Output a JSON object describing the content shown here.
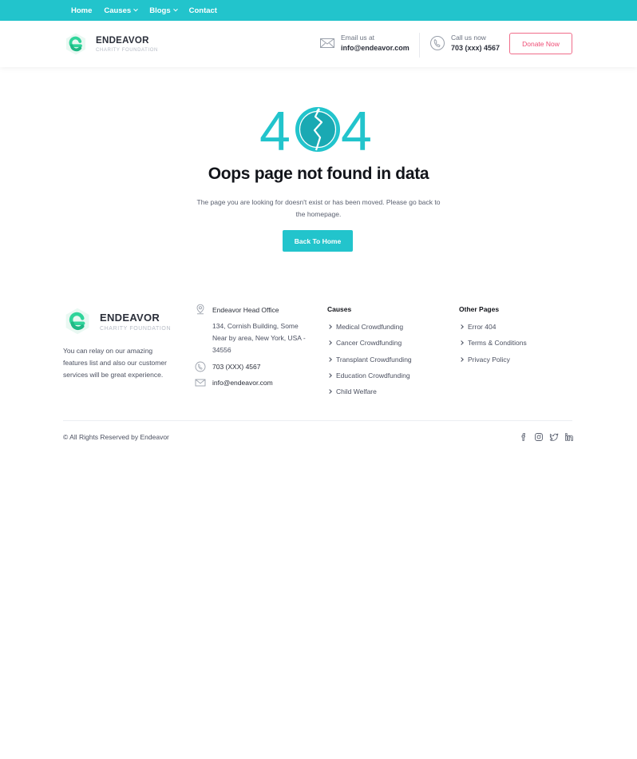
{
  "nav": {
    "items": [
      {
        "label": "Home",
        "has_dropdown": false
      },
      {
        "label": "Causes",
        "has_dropdown": true
      },
      {
        "label": "Blogs",
        "has_dropdown": true
      },
      {
        "label": "Contact",
        "has_dropdown": false
      }
    ]
  },
  "brand": {
    "name": "ENDEAVOR",
    "tagline": "CHARITY FOUNDATION",
    "colors": {
      "primary": "#22c4cc",
      "logo": "#2fd49a",
      "accent": "#ee4d75"
    }
  },
  "header": {
    "email_label": "Email us at",
    "email_value": "info@endeavor.com",
    "phone_label": "Call us now",
    "phone_value": "703 (xxx) 4567",
    "donate_label": "Donate Now"
  },
  "error": {
    "code_left": "4",
    "code_right": "4",
    "headline": "Oops page not found in data",
    "message": "The page you are looking for doesn't exist or has been moved. Please go back to the homepage.",
    "button_label": "Back To Home"
  },
  "footer": {
    "about": "You can relay on our amazing features list and also our customer services will be great experience.",
    "office_title": "Endeavor Head Office",
    "address": "134, Cornish Building, Some Near by area, New York, USA - 34556",
    "phone": "703 (XXX) 4567",
    "email": "info@endeavor.com",
    "causes_title": "Causes",
    "causes_links": [
      "Medical Crowdfunding",
      "Cancer Crowdfunding",
      "Transplant Crowdfunding",
      "Education Crowdfunding",
      "Child Welfare"
    ],
    "pages_title": "Other Pages",
    "pages_links": [
      "Error 404",
      "Terms & Conditions",
      "Privacy Policy"
    ],
    "copyright": "© All Rights Reserved by Endeavor",
    "socials": [
      "facebook-icon",
      "instagram-icon",
      "twitter-icon",
      "linkedin-icon"
    ]
  }
}
